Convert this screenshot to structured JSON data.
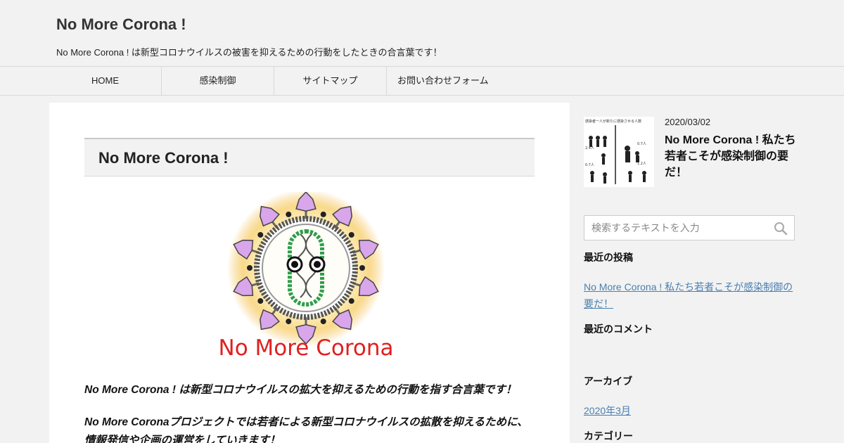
{
  "site": {
    "title": "No More Corona !",
    "description": "No More Corona ! は新型コロナウイルスの被害を抑えるための行動をしたときの合言葉です！"
  },
  "nav": {
    "items": [
      {
        "label": "HOME"
      },
      {
        "label": "感染制御"
      },
      {
        "label": "サイトマップ"
      },
      {
        "label": "お問い合わせフォーム"
      }
    ]
  },
  "post": {
    "title": "No More Corona !",
    "paragraphs": [
      "No More Corona ! は新型コロナウイルスの拡大を抑えるための行動を指す合言葉です！",
      "No More Coronaプロジェクトでは若者による新型コロナウイルスの拡散を抑えるために、情報発信や企画の運営をしていきます！"
    ]
  },
  "logo": {
    "text": "No More Corona"
  },
  "thumbnail": {
    "caption": "感染者一人が新たに感染させる人数",
    "labels": [
      "2.4人",
      "0.7人",
      "0.7人",
      "1.2人"
    ]
  },
  "sidebar": {
    "featured": {
      "date": "2020/03/02",
      "title": "No More Corona ! 私たち若者こそが感染制御の要だ！"
    },
    "search": {
      "placeholder": "検索するテキストを入力"
    },
    "recent_posts": {
      "heading": "最近の投稿",
      "items": [
        {
          "label": "No More Corona ! 私たち若者こそが感染制御の要だ！"
        }
      ]
    },
    "recent_comments": {
      "heading": "最近のコメント"
    },
    "archives": {
      "heading": "アーカイブ",
      "items": [
        {
          "label": "2020年3月"
        }
      ]
    },
    "categories": {
      "heading": "カテゴリー"
    }
  },
  "colors": {
    "background": "#f2f2f2",
    "link": "#4a7fb0",
    "logo_text": "#e02020",
    "virus_spike": "#d9a6ec",
    "virus_glow": "#f6c76a"
  }
}
